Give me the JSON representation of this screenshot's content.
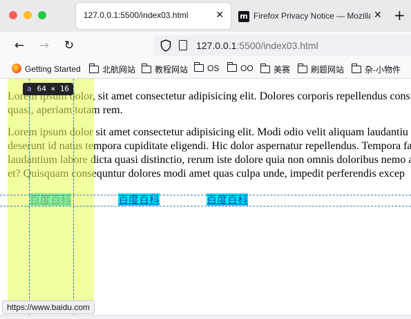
{
  "browser": {
    "active_tab": {
      "title": "127.0.0.1:5500/index03.html",
      "close": "✕"
    },
    "second_tab": {
      "icon": "m",
      "title": "Firefox Privacy Notice — Mozilla",
      "close": "✕"
    },
    "new_tab": "+",
    "nav": {
      "back": "←",
      "forward": "→",
      "reload": "↻"
    },
    "url": {
      "host": "127.0.0.1",
      "path": ":5500/index03.html"
    }
  },
  "bookmarks": [
    {
      "icon": "firefox-icon",
      "label": "Getting Started"
    },
    {
      "icon": "folder-icon",
      "label": "北航网站"
    },
    {
      "icon": "folder-icon",
      "label": "教程网站"
    },
    {
      "icon": "folder-icon",
      "label": "OS"
    },
    {
      "icon": "folder-icon",
      "label": "OO"
    },
    {
      "icon": "folder-icon",
      "label": "美赛"
    },
    {
      "icon": "folder-icon",
      "label": "刷题网站"
    },
    {
      "icon": "folder-icon",
      "label": "杂-小物件"
    }
  ],
  "content": {
    "paragraph1": [
      "Lorem ipsum dolor, sit amet consectetur adipisicing elit. Dolores corporis repellendus cons",
      "quasi, aperiam totam rem."
    ],
    "paragraph2": [
      "Lorem ipsum dolor sit amet consectetur adipisicing elit. Modi odio velit aliquam laudantiu",
      "deserunt id natus tempora cupiditate eligendi. Hic dolor aspernatur repellendus. Tempora fa",
      "laudantium labore dicta quasi distinctio, rerum iste dolore quia non omnis doloribus nemo a",
      "et? Quisquam consequntur dolores modi amet quas culpa unde, impedit perferendis excep"
    ],
    "links": [
      "百度百科",
      "百度百科",
      "百度百科"
    ]
  },
  "devtools_tooltip": {
    "tag": "a",
    "size": "64 × 16"
  },
  "status_url": "https://www.baidu.com",
  "colors": {
    "highlight": "#e8ff50",
    "link_bg": "#00e8f6",
    "guide": "#2b7bb9"
  }
}
